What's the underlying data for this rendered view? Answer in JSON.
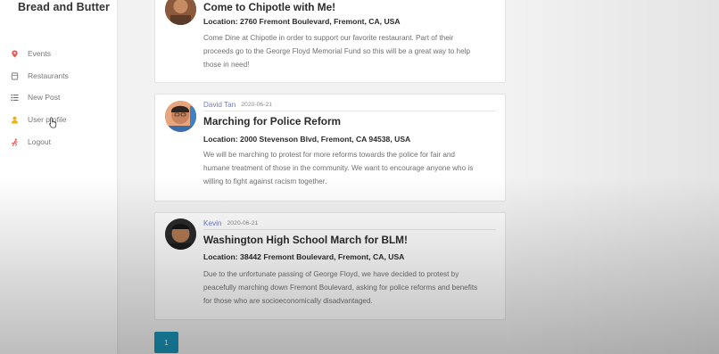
{
  "sidebar": {
    "brand": "Bread and Butter",
    "items": [
      {
        "label": "Events",
        "icon": "map-pin-icon",
        "color": "#e8574f"
      },
      {
        "label": "Restaurants",
        "icon": "restaurant-icon",
        "color": "#8a8a8a"
      },
      {
        "label": "New Post",
        "icon": "list-icon",
        "color": "#6a6a6a"
      },
      {
        "label": "User profile",
        "icon": "user-icon",
        "color": "#f0b400"
      },
      {
        "label": "Logout",
        "icon": "logout-icon",
        "color": "#e8574f"
      }
    ]
  },
  "posts": [
    {
      "title": "Come to Chipotle with Me!",
      "location": "Location: 2760 Fremont Boulevard, Fremont, CA, USA",
      "description_lines": [
        "Come Dine at Chipotle in order to support our favorite restaurant. Part of their",
        "proceeds go to the George Floyd Memorial Fund so this will be a great way to help",
        "those in need!"
      ]
    },
    {
      "author": "David Tan",
      "date": "2020-06-21",
      "title": "Marching for Police Reform",
      "location": "Location: 2000 Stevenson Blvd, Fremont, CA 94538, USA",
      "description_lines": [
        "We will be marching to protest for more reforms towards the police for fair and",
        "humane treatment of those in the community. We want to encourage anyone who is",
        "willing to fight against racism together."
      ]
    },
    {
      "author": "Kevin",
      "date": "2020-06-21",
      "title": "Washington High School March for BLM!",
      "location": "Location: 38442 Fremont Boulevard, Fremont, CA, USA",
      "description_lines": [
        "Due to the unfortunate passing of George Floyd, we have decided to protest by",
        "peacefully marching down Fremont Boulevard, asking for police reforms and benefits",
        "for those who are socioeconomically disadvantaged."
      ]
    }
  ],
  "pagination": {
    "current": "1"
  },
  "colors": {
    "accent": "#1a93b8",
    "author": "#6f7bd0"
  }
}
